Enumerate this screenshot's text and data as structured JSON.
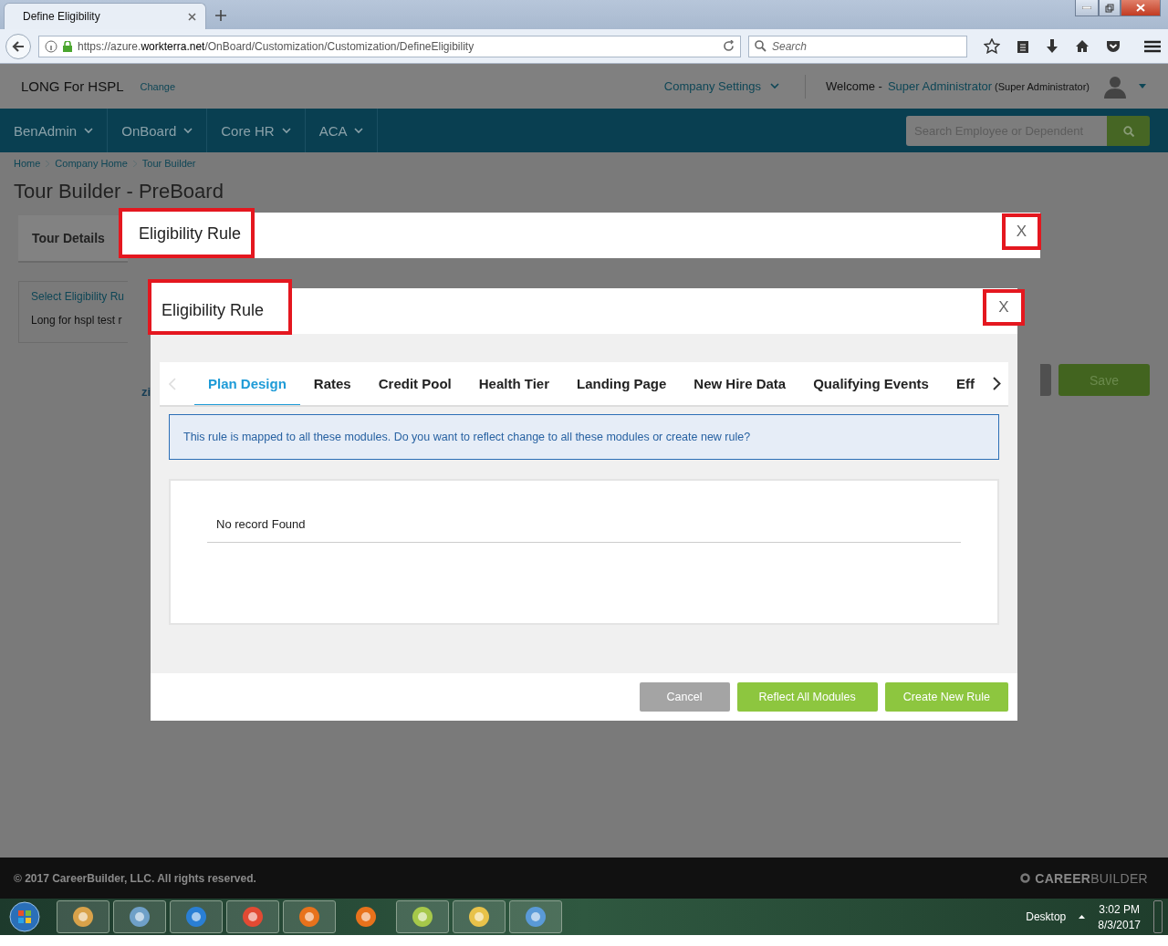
{
  "browser": {
    "tab_title": "Define Eligibility",
    "url_prefix": "https://azure.",
    "url_domain": "workterra.net",
    "url_path": "/OnBoard/Customization/Customization/DefineEligibility",
    "search_placeholder": "Search"
  },
  "header": {
    "company": "LONG For HSPL",
    "change_link": "Change",
    "settings_menu": "Company Settings",
    "welcome": "Welcome -",
    "user": "Super Administrator",
    "role": "(Super Administrator)"
  },
  "nav": {
    "menus": [
      {
        "label": "BenAdmin"
      },
      {
        "label": "OnBoard"
      },
      {
        "label": "Core HR"
      },
      {
        "label": "ACA"
      }
    ],
    "search_placeholder": "Search Employee or Dependent"
  },
  "breadcrumb": [
    "Home",
    "Company Home",
    "Tour Builder"
  ],
  "page_title": "Tour Builder - PreBoard",
  "background": {
    "tour_tab": "Tour Details",
    "card_link": "Select Eligibility Ru",
    "card_text": "Long for hspl test r",
    "partial_label": "zi",
    "save_button": "Save"
  },
  "outer_dialog": {
    "title": "Eligibility Rule",
    "close": "X"
  },
  "dialog": {
    "title": "Eligibility Rule",
    "close": "X",
    "tabs": [
      {
        "label": "Plan Design",
        "selected": true
      },
      {
        "label": "Rates",
        "selected": false
      },
      {
        "label": "Credit Pool",
        "selected": false
      },
      {
        "label": "Health Tier",
        "selected": false
      },
      {
        "label": "Landing Page",
        "selected": false
      },
      {
        "label": "New Hire Data",
        "selected": false
      },
      {
        "label": "Qualifying Events",
        "selected": false
      },
      {
        "label": "Eff",
        "selected": false
      }
    ],
    "alert": "This rule is mapped to all these modules. Do you want to reflect change to all these modules or create new rule?",
    "empty_text": "No record Found",
    "buttons": [
      {
        "label": "Cancel",
        "kind": "secondary"
      },
      {
        "label": "Reflect All Modules",
        "kind": "primary"
      },
      {
        "label": "Create New Rule",
        "kind": "primary"
      }
    ]
  },
  "footer": {
    "copyright": "© 2017 CareerBuilder, LLC. All rights reserved.",
    "logo": "**CAREER**BUILDER"
  },
  "taskbar": {
    "desktop": "Desktop",
    "time": "3:02 PM",
    "date": "8/3/2017"
  }
}
